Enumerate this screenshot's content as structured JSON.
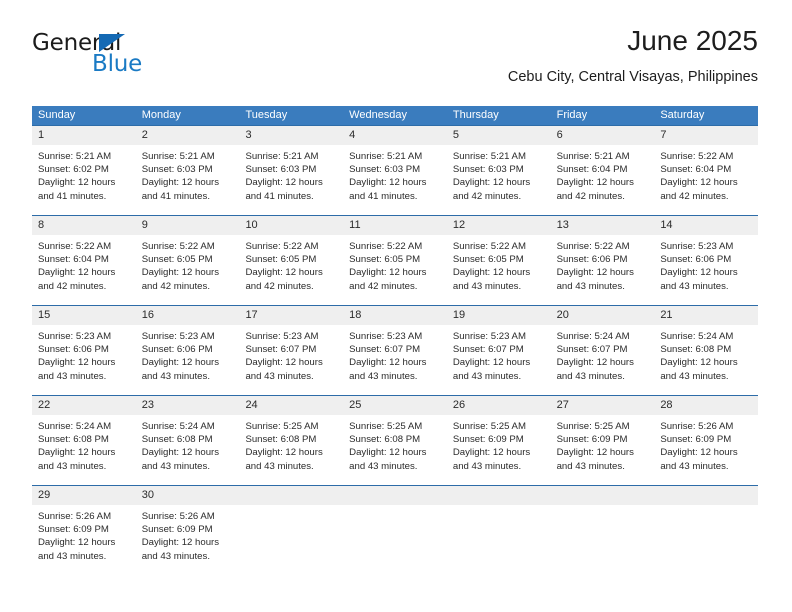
{
  "brand": {
    "name_part1": "General",
    "name_part2": "Blue",
    "logo_icon": "triangle-flag-icon"
  },
  "header": {
    "title": "June 2025",
    "subtitle": "Cebu City, Central Visayas, Philippines"
  },
  "calendar": {
    "weekdays": [
      "Sunday",
      "Monday",
      "Tuesday",
      "Wednesday",
      "Thursday",
      "Friday",
      "Saturday"
    ],
    "colors": {
      "header_blue": "#3a7cbe",
      "row_divider_blue": "#2d6ca8",
      "daynum_band_gray": "#efefef",
      "brand_blue": "#1a7ac4"
    },
    "weeks": [
      [
        {
          "day": "1",
          "sunrise": "Sunrise: 5:21 AM",
          "sunset": "Sunset: 6:02 PM",
          "daylight1": "Daylight: 12 hours",
          "daylight2": "and 41 minutes."
        },
        {
          "day": "2",
          "sunrise": "Sunrise: 5:21 AM",
          "sunset": "Sunset: 6:03 PM",
          "daylight1": "Daylight: 12 hours",
          "daylight2": "and 41 minutes."
        },
        {
          "day": "3",
          "sunrise": "Sunrise: 5:21 AM",
          "sunset": "Sunset: 6:03 PM",
          "daylight1": "Daylight: 12 hours",
          "daylight2": "and 41 minutes."
        },
        {
          "day": "4",
          "sunrise": "Sunrise: 5:21 AM",
          "sunset": "Sunset: 6:03 PM",
          "daylight1": "Daylight: 12 hours",
          "daylight2": "and 41 minutes."
        },
        {
          "day": "5",
          "sunrise": "Sunrise: 5:21 AM",
          "sunset": "Sunset: 6:03 PM",
          "daylight1": "Daylight: 12 hours",
          "daylight2": "and 42 minutes."
        },
        {
          "day": "6",
          "sunrise": "Sunrise: 5:21 AM",
          "sunset": "Sunset: 6:04 PM",
          "daylight1": "Daylight: 12 hours",
          "daylight2": "and 42 minutes."
        },
        {
          "day": "7",
          "sunrise": "Sunrise: 5:22 AM",
          "sunset": "Sunset: 6:04 PM",
          "daylight1": "Daylight: 12 hours",
          "daylight2": "and 42 minutes."
        }
      ],
      [
        {
          "day": "8",
          "sunrise": "Sunrise: 5:22 AM",
          "sunset": "Sunset: 6:04 PM",
          "daylight1": "Daylight: 12 hours",
          "daylight2": "and 42 minutes."
        },
        {
          "day": "9",
          "sunrise": "Sunrise: 5:22 AM",
          "sunset": "Sunset: 6:05 PM",
          "daylight1": "Daylight: 12 hours",
          "daylight2": "and 42 minutes."
        },
        {
          "day": "10",
          "sunrise": "Sunrise: 5:22 AM",
          "sunset": "Sunset: 6:05 PM",
          "daylight1": "Daylight: 12 hours",
          "daylight2": "and 42 minutes."
        },
        {
          "day": "11",
          "sunrise": "Sunrise: 5:22 AM",
          "sunset": "Sunset: 6:05 PM",
          "daylight1": "Daylight: 12 hours",
          "daylight2": "and 42 minutes."
        },
        {
          "day": "12",
          "sunrise": "Sunrise: 5:22 AM",
          "sunset": "Sunset: 6:05 PM",
          "daylight1": "Daylight: 12 hours",
          "daylight2": "and 43 minutes."
        },
        {
          "day": "13",
          "sunrise": "Sunrise: 5:22 AM",
          "sunset": "Sunset: 6:06 PM",
          "daylight1": "Daylight: 12 hours",
          "daylight2": "and 43 minutes."
        },
        {
          "day": "14",
          "sunrise": "Sunrise: 5:23 AM",
          "sunset": "Sunset: 6:06 PM",
          "daylight1": "Daylight: 12 hours",
          "daylight2": "and 43 minutes."
        }
      ],
      [
        {
          "day": "15",
          "sunrise": "Sunrise: 5:23 AM",
          "sunset": "Sunset: 6:06 PM",
          "daylight1": "Daylight: 12 hours",
          "daylight2": "and 43 minutes."
        },
        {
          "day": "16",
          "sunrise": "Sunrise: 5:23 AM",
          "sunset": "Sunset: 6:06 PM",
          "daylight1": "Daylight: 12 hours",
          "daylight2": "and 43 minutes."
        },
        {
          "day": "17",
          "sunrise": "Sunrise: 5:23 AM",
          "sunset": "Sunset: 6:07 PM",
          "daylight1": "Daylight: 12 hours",
          "daylight2": "and 43 minutes."
        },
        {
          "day": "18",
          "sunrise": "Sunrise: 5:23 AM",
          "sunset": "Sunset: 6:07 PM",
          "daylight1": "Daylight: 12 hours",
          "daylight2": "and 43 minutes."
        },
        {
          "day": "19",
          "sunrise": "Sunrise: 5:23 AM",
          "sunset": "Sunset: 6:07 PM",
          "daylight1": "Daylight: 12 hours",
          "daylight2": "and 43 minutes."
        },
        {
          "day": "20",
          "sunrise": "Sunrise: 5:24 AM",
          "sunset": "Sunset: 6:07 PM",
          "daylight1": "Daylight: 12 hours",
          "daylight2": "and 43 minutes."
        },
        {
          "day": "21",
          "sunrise": "Sunrise: 5:24 AM",
          "sunset": "Sunset: 6:08 PM",
          "daylight1": "Daylight: 12 hours",
          "daylight2": "and 43 minutes."
        }
      ],
      [
        {
          "day": "22",
          "sunrise": "Sunrise: 5:24 AM",
          "sunset": "Sunset: 6:08 PM",
          "daylight1": "Daylight: 12 hours",
          "daylight2": "and 43 minutes."
        },
        {
          "day": "23",
          "sunrise": "Sunrise: 5:24 AM",
          "sunset": "Sunset: 6:08 PM",
          "daylight1": "Daylight: 12 hours",
          "daylight2": "and 43 minutes."
        },
        {
          "day": "24",
          "sunrise": "Sunrise: 5:25 AM",
          "sunset": "Sunset: 6:08 PM",
          "daylight1": "Daylight: 12 hours",
          "daylight2": "and 43 minutes."
        },
        {
          "day": "25",
          "sunrise": "Sunrise: 5:25 AM",
          "sunset": "Sunset: 6:08 PM",
          "daylight1": "Daylight: 12 hours",
          "daylight2": "and 43 minutes."
        },
        {
          "day": "26",
          "sunrise": "Sunrise: 5:25 AM",
          "sunset": "Sunset: 6:09 PM",
          "daylight1": "Daylight: 12 hours",
          "daylight2": "and 43 minutes."
        },
        {
          "day": "27",
          "sunrise": "Sunrise: 5:25 AM",
          "sunset": "Sunset: 6:09 PM",
          "daylight1": "Daylight: 12 hours",
          "daylight2": "and 43 minutes."
        },
        {
          "day": "28",
          "sunrise": "Sunrise: 5:26 AM",
          "sunset": "Sunset: 6:09 PM",
          "daylight1": "Daylight: 12 hours",
          "daylight2": "and 43 minutes."
        }
      ],
      [
        {
          "day": "29",
          "sunrise": "Sunrise: 5:26 AM",
          "sunset": "Sunset: 6:09 PM",
          "daylight1": "Daylight: 12 hours",
          "daylight2": "and 43 minutes."
        },
        {
          "day": "30",
          "sunrise": "Sunrise: 5:26 AM",
          "sunset": "Sunset: 6:09 PM",
          "daylight1": "Daylight: 12 hours",
          "daylight2": "and 43 minutes."
        },
        {
          "day": "",
          "sunrise": "",
          "sunset": "",
          "daylight1": "",
          "daylight2": ""
        },
        {
          "day": "",
          "sunrise": "",
          "sunset": "",
          "daylight1": "",
          "daylight2": ""
        },
        {
          "day": "",
          "sunrise": "",
          "sunset": "",
          "daylight1": "",
          "daylight2": ""
        },
        {
          "day": "",
          "sunrise": "",
          "sunset": "",
          "daylight1": "",
          "daylight2": ""
        },
        {
          "day": "",
          "sunrise": "",
          "sunset": "",
          "daylight1": "",
          "daylight2": ""
        }
      ]
    ]
  }
}
